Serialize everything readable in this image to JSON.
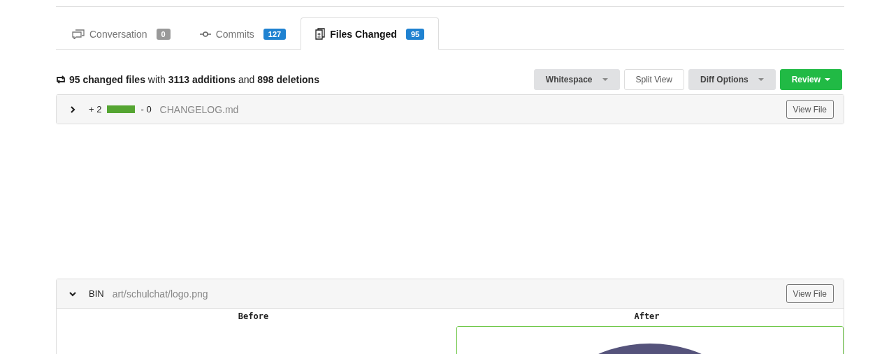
{
  "tabs": [
    {
      "label": "Conversation",
      "count": "0",
      "selected": false
    },
    {
      "label": "Commits",
      "count": "127",
      "selected": false
    },
    {
      "label": "Files Changed",
      "count": "95",
      "selected": true
    }
  ],
  "summary": "**95 changed files** with **3113 additions** and **898 deletions**",
  "buttons": [
    {
      "label": "Whitespace",
      "kind": "dropdown"
    },
    {
      "label": "Split View",
      "kind": "plain"
    },
    {
      "label": "Diff Options",
      "kind": "dropdown"
    },
    {
      "label": "Review",
      "kind": "primary"
    }
  ],
  "files": [
    {
      "expanded": false,
      "additions": "+ 2",
      "deletions": "- 0",
      "name": "CHANGELOG.md",
      "button": "View File"
    },
    {
      "expanded": true,
      "badge": "BIN",
      "name": "art/schulchat/logo.png",
      "button": "View File",
      "before_label": "Before",
      "after_label": "After"
    }
  ]
}
